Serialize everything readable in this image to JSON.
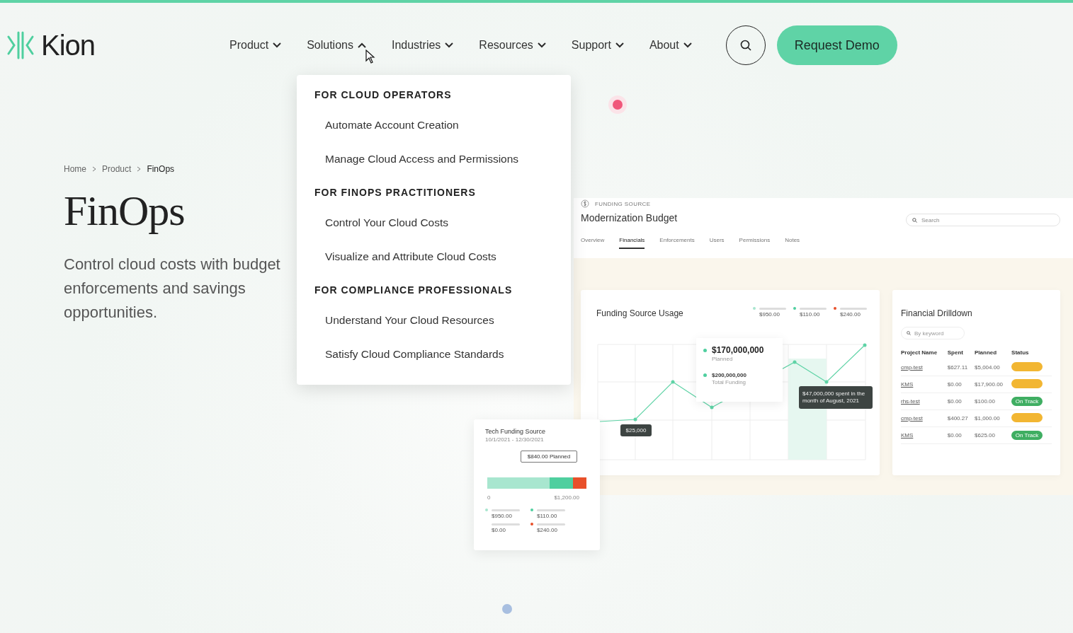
{
  "header": {
    "logo": "Kion",
    "nav": [
      {
        "label": "Product",
        "expanded": false
      },
      {
        "label": "Solutions",
        "expanded": true
      },
      {
        "label": "Industries",
        "expanded": false
      },
      {
        "label": "Resources",
        "expanded": false
      },
      {
        "label": "Support",
        "expanded": false
      },
      {
        "label": "About",
        "expanded": false
      }
    ],
    "cta": "Request Demo"
  },
  "breadcrumb": [
    "Home",
    "Product",
    "FinOps"
  ],
  "hero": {
    "title": "FinOps",
    "subtitle": "Control cloud costs with budget enforcements and savings opportunities."
  },
  "menu": {
    "sections": [
      {
        "heading": "FOR CLOUD OPERATORS",
        "items": [
          "Automate Account Creation",
          "Manage Cloud Access and Permissions"
        ]
      },
      {
        "heading": "FOR FINOPS PRACTITIONERS",
        "items": [
          "Control Your Cloud Costs",
          "Visualize and Attribute Cloud Costs"
        ]
      },
      {
        "heading": "FOR COMPLIANCE PROFESSIONALS",
        "items": [
          "Understand Your Cloud Resources",
          "Satisfy Cloud Compliance Standards"
        ]
      }
    ]
  },
  "dashboard": {
    "eyebrow": "FUNDING SOURCE",
    "title": "Modernization Budget",
    "search_placeholder": "Search",
    "tabs": [
      {
        "label": "Overview",
        "selected": false
      },
      {
        "label": "Financials",
        "selected": true
      },
      {
        "label": "Enforcements",
        "selected": false
      },
      {
        "label": "Users",
        "selected": false
      },
      {
        "label": "Permissions",
        "selected": false
      },
      {
        "label": "Notes",
        "selected": false
      }
    ],
    "usage": {
      "title": "Funding Source Usage",
      "legend": [
        {
          "value": "$950.00",
          "color": "#a8e6cf"
        },
        {
          "value": "$110.00",
          "color": "#4fcf9f"
        },
        {
          "value": "$240.00",
          "color": "#e8502a"
        }
      ],
      "tooltip": {
        "primary_value": "$170,000,000",
        "primary_label": "Planned",
        "secondary_value": "$200,000,000",
        "secondary_label": "Total Funding"
      },
      "point_label": "$25,000",
      "note": "$47,000,000 spent in the month of August, 2021"
    },
    "drilldown": {
      "title": "Financial Drilldown",
      "placeholder": "By keyword",
      "columns": [
        "Project Name",
        "Spent",
        "Planned",
        "Status"
      ],
      "rows": [
        {
          "project": "cmp-test",
          "spent": "$627.11",
          "planned": "$5,004.00",
          "status": {
            "color": "#f2b632"
          }
        },
        {
          "project": "KMS",
          "spent": "$0.00",
          "planned": "$17,900.00",
          "status": {
            "color": "#f2b632"
          }
        },
        {
          "project": "rhs-test",
          "spent": "$0.00",
          "planned": "$100.00",
          "status": {
            "label": "On Track",
            "color": "#3fae62"
          }
        },
        {
          "project": "cmp-test",
          "spent": "$400.27",
          "planned": "$1,000.00",
          "status": {
            "color": "#f2b632"
          }
        },
        {
          "project": "KMS",
          "spent": "$0.00",
          "planned": "$625.00",
          "status": {
            "label": "On Track",
            "color": "#3fae62"
          }
        }
      ]
    },
    "tech": {
      "title": "Tech Funding Source",
      "dates": "10/1/2021 - 12/30/2021",
      "callout": "$840.00 Planned",
      "axis": [
        "0",
        "$1,200.00"
      ],
      "legend": [
        {
          "value": "$950.00",
          "color": "#a8e6cf"
        },
        {
          "value": "$110.00",
          "color": "#4fcf9f"
        },
        {
          "value": "$0.00"
        },
        {
          "value": "$240.00",
          "color": "#e8502a"
        }
      ]
    }
  }
}
